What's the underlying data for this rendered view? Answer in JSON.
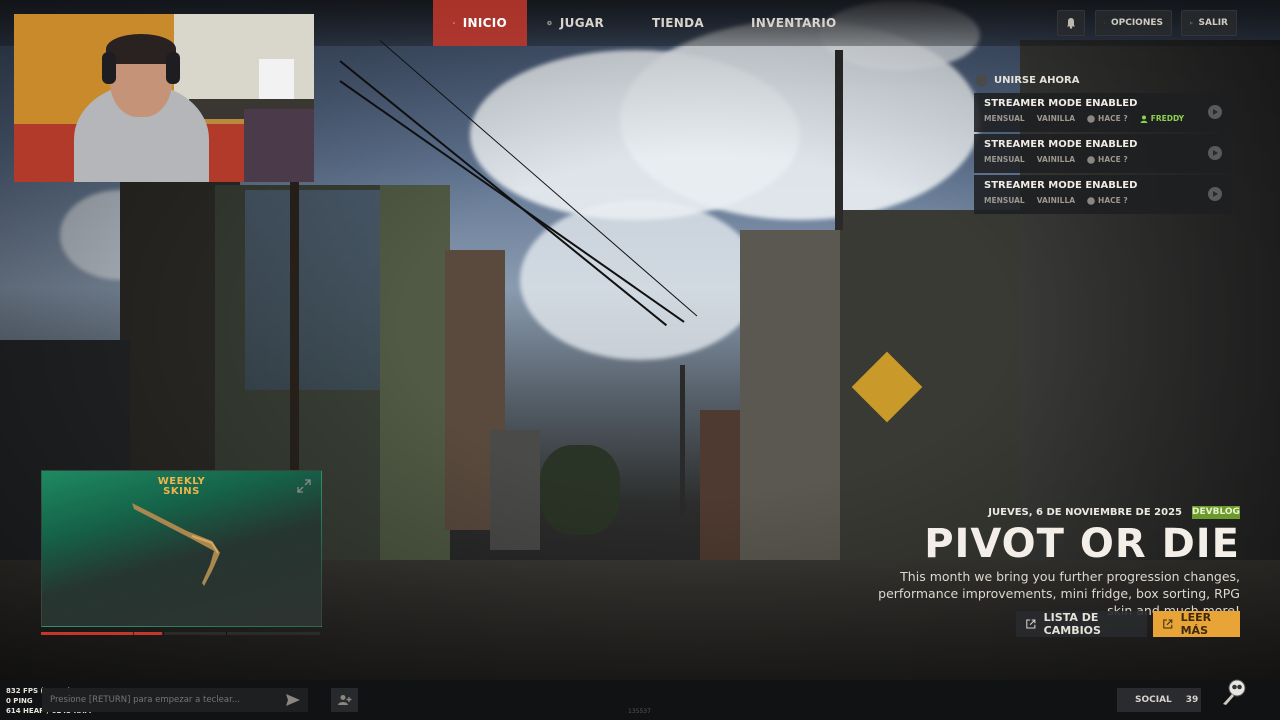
{
  "nav": {
    "items": [
      {
        "label": "INICIO",
        "icon": "home-icon",
        "active": true
      },
      {
        "label": "JUGAR",
        "icon": "play-icon",
        "active": false
      },
      {
        "label": "TIENDA",
        "icon": "store-icon",
        "active": false
      },
      {
        "label": "INVENTARIO",
        "icon": "box-icon",
        "active": false
      }
    ],
    "notifications_icon": "bell-icon",
    "options_label": "OPCIONES",
    "exit_label": "SALIR"
  },
  "servers": {
    "header": "UNIRSE AHORA",
    "list": [
      {
        "name": "STREAMER MODE ENABLED",
        "type": "MENSUAL",
        "mode": "VAINILLA",
        "ago": "HACE ?",
        "friend": "FREDDY"
      },
      {
        "name": "STREAMER MODE ENABLED",
        "type": "MENSUAL",
        "mode": "VAINILLA",
        "ago": "HACE ?",
        "friend": ""
      },
      {
        "name": "STREAMER MODE ENABLED",
        "type": "MENSUAL",
        "mode": "VAINILLA",
        "ago": "HACE ?",
        "friend": ""
      }
    ]
  },
  "weekly_skins": {
    "line1": "WEEKLY",
    "line2": "SKINS",
    "expand_icon": "expand-icon"
  },
  "news": {
    "date": "JUEVES, 6 DE NOVIEMBRE DE 2025",
    "tag": "DEVBLOG",
    "title": "PIVOT OR DIE",
    "description": "This month we bring you further progression changes, performance improvements, mini fridge, box sorting, RPG skin and much more!",
    "changelog_label": "LISTA DE CAMBIOS",
    "read_more_label": "LEER MÁS"
  },
  "stats": {
    "fps": "832 FPS (1.2ms)",
    "ping": "0 PING",
    "memory": "614 HEAP / 6243 RAM"
  },
  "chat": {
    "placeholder": "Presione [RETURN] para empezar a teclear..."
  },
  "build_number": "135537",
  "social": {
    "label": "SOCIAL",
    "count": "39"
  },
  "colors": {
    "accent_red": "#c4382b",
    "devblog_green": "#6d9a2c",
    "gold_button": "#e8a437",
    "friend_green": "#8fd14f"
  }
}
